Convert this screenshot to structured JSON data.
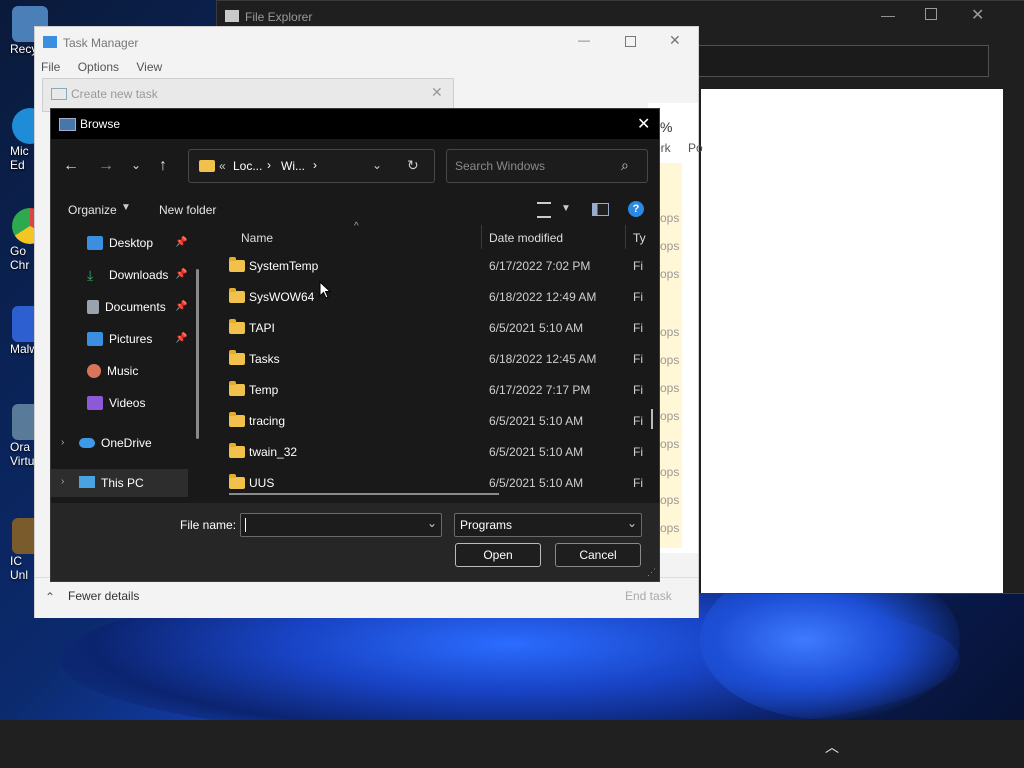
{
  "desktop": {
    "icons": [
      {
        "label": "Recy",
        "color": "#4a7fb8"
      },
      {
        "label": "Mic",
        "label2": "Ed",
        "color": "#1f8cd8"
      },
      {
        "label": "Go",
        "label2": "Chr",
        "color": "#d44"
      },
      {
        "label": "Malwa",
        "color": "#2d5fd0"
      },
      {
        "label": "Ora",
        "label2": "Virtu",
        "color": "#5a7a99"
      },
      {
        "label": "IC",
        "label2": "Unl",
        "color": "#7a5b2b"
      }
    ]
  },
  "file_explorer": {
    "title": "File Explorer"
  },
  "task_manager": {
    "title": "Task Manager",
    "menu": [
      "File",
      "Options",
      "View"
    ],
    "col_percent": "%",
    "col_work": "ork",
    "col_po": "Po",
    "ops_label": "ops",
    "fewer_details": "Fewer details",
    "end_task": "End task"
  },
  "create_task": {
    "title": "Create new task"
  },
  "browse": {
    "title": "Browse",
    "address": {
      "crumb1": "Loc...",
      "crumb2": "Wi...",
      "sep": "›",
      "prefix": "«"
    },
    "search_placeholder": "Search Windows",
    "organize": "Organize",
    "new_folder": "New folder",
    "nav_items": [
      {
        "label": "Desktop",
        "color": "#3b8fe0",
        "pinned": true
      },
      {
        "label": "Downloads",
        "color": "#33b36b",
        "pinned": true
      },
      {
        "label": "Documents",
        "color": "#9aa3ad",
        "pinned": true
      },
      {
        "label": "Pictures",
        "color": "#3b8fe0",
        "pinned": true
      },
      {
        "label": "Music",
        "color": "#d9745a",
        "pinned": false
      },
      {
        "label": "Videos",
        "color": "#8c5ad9",
        "pinned": false
      },
      {
        "label": "OneDrive",
        "color": "#3d9ae8",
        "pinned": false
      },
      {
        "label": "This PC",
        "color": "#4aa3e0",
        "pinned": false
      }
    ],
    "columns": {
      "name": "Name",
      "date": "Date modified",
      "type": "Ty"
    },
    "files": [
      {
        "name": "SystemTemp",
        "date": "6/17/2022 7:02 PM",
        "type": "Fi"
      },
      {
        "name": "SysWOW64",
        "date": "6/18/2022 12:49 AM",
        "type": "Fi"
      },
      {
        "name": "TAPI",
        "date": "6/5/2021 5:10 AM",
        "type": "Fi"
      },
      {
        "name": "Tasks",
        "date": "6/18/2022 12:45 AM",
        "type": "Fi"
      },
      {
        "name": "Temp",
        "date": "6/17/2022 7:17 PM",
        "type": "Fi"
      },
      {
        "name": "tracing",
        "date": "6/5/2021 5:10 AM",
        "type": "Fi"
      },
      {
        "name": "twain_32",
        "date": "6/5/2021 5:10 AM",
        "type": "Fi"
      },
      {
        "name": "UUS",
        "date": "6/5/2021 5:10 AM",
        "type": "Fi"
      }
    ],
    "file_name_label": "File name:",
    "file_name_value": "",
    "file_type": "Programs",
    "open": "Open",
    "cancel": "Cancel"
  }
}
